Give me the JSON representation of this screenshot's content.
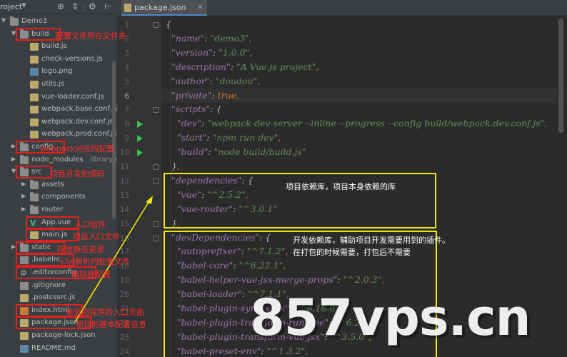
{
  "project_panel": {
    "title": "roject",
    "tree": [
      {
        "label": "Demo3",
        "icon": "folder-icon",
        "kind": "folder-open"
      },
      {
        "label": "build",
        "icon": "folder-icon",
        "kind": "folder-open",
        "annotation": "配置文件所在文件夹"
      },
      {
        "label": "build.js",
        "icon": "js-file-icon",
        "kind": "file"
      },
      {
        "label": "check-versions.js",
        "icon": "js-file-icon",
        "kind": "file"
      },
      {
        "label": "logo.png",
        "icon": "image-file-icon",
        "kind": "file"
      },
      {
        "label": "utils.js",
        "icon": "js-file-icon",
        "kind": "file"
      },
      {
        "label": "vue-loader.conf.js",
        "icon": "js-file-icon",
        "kind": "file"
      },
      {
        "label": "webpack.base.conf.js",
        "icon": "js-file-icon",
        "kind": "file"
      },
      {
        "label": "webpack.dev.conf.js",
        "icon": "js-file-icon",
        "kind": "file"
      },
      {
        "label": "webpack.prod.conf.js",
        "icon": "js-file-icon",
        "kind": "file"
      },
      {
        "label": "config",
        "icon": "folder-icon",
        "kind": "folder-closed",
        "annotation": "webpack对应的配置"
      },
      {
        "label": "node_modules",
        "note": "library root",
        "icon": "folder-icon",
        "kind": "folder-closed"
      },
      {
        "label": "src",
        "icon": "folder-icon",
        "kind": "folder-open",
        "annotation": "项目开发的源码"
      },
      {
        "label": "assets",
        "icon": "folder-icon",
        "kind": "folder-closed"
      },
      {
        "label": "components",
        "icon": "folder-icon",
        "kind": "folder-closed"
      },
      {
        "label": "router",
        "icon": "folder-icon",
        "kind": "folder-closed"
      },
      {
        "label": "App.vue",
        "icon": "vue-file-icon",
        "kind": "file",
        "annotation": "入口组件"
      },
      {
        "label": "main.js",
        "icon": "js-file-icon",
        "kind": "file",
        "annotation": "项目入口文件"
      },
      {
        "label": "static",
        "icon": "folder-icon",
        "kind": "folder-closed",
        "annotation": "存放静态资源"
      },
      {
        "label": ".babelrc",
        "icon": "file-icon",
        "kind": "file",
        "annotation": "ES6解析的配置文件"
      },
      {
        "label": ".editorconfig",
        "icon": "gear-icon",
        "kind": "file",
        "annotation": "编辑器配置"
      },
      {
        "label": ".gitignore",
        "icon": "file-icon",
        "kind": "file"
      },
      {
        "label": ".postcssrc.js",
        "icon": "js-file-icon",
        "kind": "file"
      },
      {
        "label": "index.html",
        "icon": "html-file-icon",
        "kind": "file",
        "annotation": "单页面程序的入口页面"
      },
      {
        "label": "package.json",
        "icon": "json-file-icon",
        "kind": "file",
        "annotation": "项目的基本配置信息"
      },
      {
        "label": "package-lock.json",
        "icon": "json-file-icon",
        "kind": "file"
      },
      {
        "label": "README.md",
        "icon": "markdown-file-icon",
        "kind": "file"
      }
    ]
  },
  "editor": {
    "tab_label": "package.json",
    "line_numbers": [
      "1",
      "2",
      "3",
      "4",
      "5",
      "6",
      "7",
      "8",
      "9",
      "10",
      "11",
      "12",
      "13",
      "14",
      "15",
      "16",
      "17",
      "18",
      "19",
      "20",
      "21",
      "22",
      "23",
      "24"
    ],
    "current_line": "6",
    "lines": [
      "{",
      "  \"name\": \"demo3\",",
      "  \"version\": \"1.0.0\",",
      "  \"description\": \"A Vue.js project\",",
      "  \"author\": \"doudou\",",
      "  \"private\": true,",
      "  \"scripts\": {",
      "    \"dev\": \"webpack-dev-server --inline --progress --config build/webpack.dev.conf.js\",",
      "    \"start\": \"npm run dev\",",
      "    \"build\": \"node build/build.js\"",
      "  },",
      "  \"dependencies\": {",
      "    \"vue\": \"^2.5.2\",",
      "    \"vue-router\": \"^3.0.1\"",
      "  },",
      "  \"devDependencies\": {",
      "    \"autoprefixer\": \"^7.1.2\",",
      "    \"babel-core\": \"^6.22.1\",",
      "    \"babel-helper-vue-jsx-merge-props\": \"^2.0.3\",",
      "    \"babel-loader\": \"^7.1.1\",",
      "    \"babel-plugin-syntax-jsx\": \"^6.18.0\",",
      "    \"babel-plugin-transform-runtime\": \"^6.22.0\",",
      "    \"babel-plugin-transform-vue-jsx\": \"^3.5.0\",",
      "    \"babel-preset-env\": \"^1.3.2\","
    ],
    "callouts": {
      "dependencies": "项目依赖库，项目本身依赖的库",
      "devDependencies_1": "开发依赖库，辅助项目开发需要用到的插件。",
      "devDependencies_2": "在打包的时候需要，打包后不需要"
    }
  },
  "watermark": "857vps.cn",
  "colors": {
    "annotation": "#ff2a2a",
    "callout_box": "#f2e800",
    "run_icon": "#3fbf4f"
  }
}
